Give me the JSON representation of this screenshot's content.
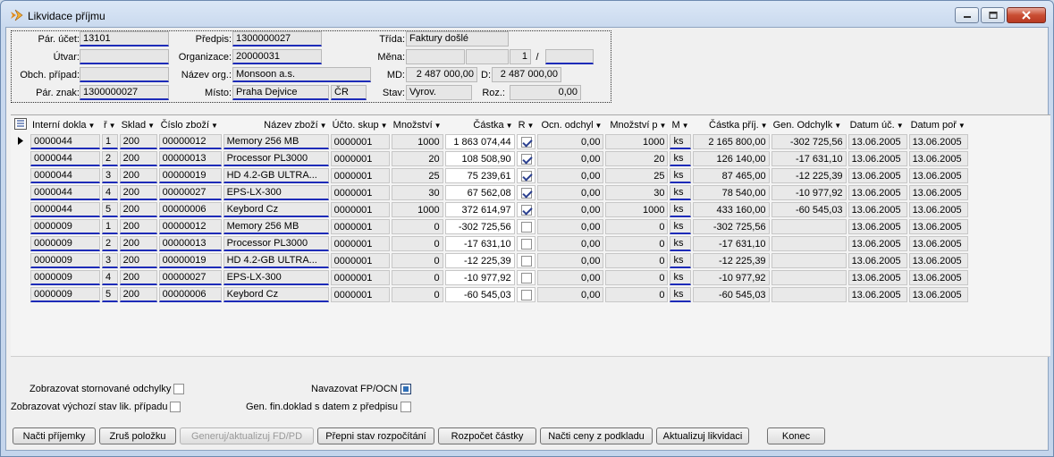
{
  "window": {
    "title": "Likvidace příjmu"
  },
  "header": {
    "par_ucet_label": "Pár. účet:",
    "par_ucet": "13101",
    "predpis_label": "Předpis:",
    "predpis": "1300000027",
    "trida_label": "Třída:",
    "trida": "Faktury došlé",
    "utvar_label": "Útvar:",
    "utvar": "",
    "organizace_label": "Organizace:",
    "organizace": "20000031",
    "mena_label": "Měna:",
    "mena1": "",
    "mena2": "",
    "mena_kurz": "1",
    "mena_slash": "/",
    "mena3": "",
    "obch_pripad_label": "Obch. případ:",
    "obch_pripad": "",
    "nazev_org_label": "Název org.:",
    "nazev_org": "Monsoon a.s.",
    "md_label": "MD:",
    "md": "2 487 000,00",
    "d_label": "D:",
    "d": "2 487 000,00",
    "par_znak_label": "Pár. znak:",
    "par_znak": "1300000027",
    "misto_label": "Místo:",
    "misto": "Praha Dejvice",
    "misto_stat": "ČR",
    "stav_label": "Stav:",
    "stav": "Vyrov.",
    "roz_label": "Roz.:",
    "roz": "0,00"
  },
  "grid": {
    "columns": [
      "Interní dokla",
      "ř",
      "Sklad",
      "Číslo zboží",
      "Název zboží",
      "Účto. skup",
      "Množství",
      "Částka",
      "R",
      "Ocn. odchyl",
      "Množství p",
      "M",
      "Částka příj.",
      "Gen. Odchylk",
      "Datum úč.",
      "Datum poř"
    ],
    "rows": [
      {
        "doc": "0000044",
        "r": "1",
        "sklad": "200",
        "cislo": "00000012",
        "nazev": "Memory 256 MB",
        "ucto": "0000001",
        "mnoz": "1000",
        "castka": "1 863 074,44",
        "chk": true,
        "ocn": "0,00",
        "mnozp": "1000",
        "m": "ks",
        "castkap": "2 165 800,00",
        "gen": "-302 725,56",
        "duc": "13.06.2005",
        "dpor": "13.06.2005"
      },
      {
        "doc": "0000044",
        "r": "2",
        "sklad": "200",
        "cislo": "00000013",
        "nazev": "Processor  PL3000",
        "ucto": "0000001",
        "mnoz": "20",
        "castka": "108 508,90",
        "chk": true,
        "ocn": "0,00",
        "mnozp": "20",
        "m": "ks",
        "castkap": "126 140,00",
        "gen": "-17 631,10",
        "duc": "13.06.2005",
        "dpor": "13.06.2005"
      },
      {
        "doc": "0000044",
        "r": "3",
        "sklad": "200",
        "cislo": "00000019",
        "nazev": "HD 4.2-GB ULTRA...",
        "ucto": "0000001",
        "mnoz": "25",
        "castka": "75 239,61",
        "chk": true,
        "ocn": "0,00",
        "mnozp": "25",
        "m": "ks",
        "castkap": "87 465,00",
        "gen": "-12 225,39",
        "duc": "13.06.2005",
        "dpor": "13.06.2005"
      },
      {
        "doc": "0000044",
        "r": "4",
        "sklad": "200",
        "cislo": "00000027",
        "nazev": "EPS-LX-300",
        "ucto": "0000001",
        "mnoz": "30",
        "castka": "67 562,08",
        "chk": true,
        "ocn": "0,00",
        "mnozp": "30",
        "m": "ks",
        "castkap": "78 540,00",
        "gen": "-10 977,92",
        "duc": "13.06.2005",
        "dpor": "13.06.2005"
      },
      {
        "doc": "0000044",
        "r": "5",
        "sklad": "200",
        "cislo": "00000006",
        "nazev": "Keybord Cz",
        "ucto": "0000001",
        "mnoz": "1000",
        "castka": "372 614,97",
        "chk": true,
        "ocn": "0,00",
        "mnozp": "1000",
        "m": "ks",
        "castkap": "433 160,00",
        "gen": "-60 545,03",
        "duc": "13.06.2005",
        "dpor": "13.06.2005"
      },
      {
        "doc": "0000009",
        "r": "1",
        "sklad": "200",
        "cislo": "00000012",
        "nazev": "Memory 256 MB",
        "ucto": "0000001",
        "mnoz": "0",
        "castka": "-302 725,56",
        "chk": false,
        "ocn": "0,00",
        "mnozp": "0",
        "m": "ks",
        "castkap": "-302 725,56",
        "gen": "",
        "duc": "13.06.2005",
        "dpor": "13.06.2005"
      },
      {
        "doc": "0000009",
        "r": "2",
        "sklad": "200",
        "cislo": "00000013",
        "nazev": "Processor  PL3000",
        "ucto": "0000001",
        "mnoz": "0",
        "castka": "-17 631,10",
        "chk": false,
        "ocn": "0,00",
        "mnozp": "0",
        "m": "ks",
        "castkap": "-17 631,10",
        "gen": "",
        "duc": "13.06.2005",
        "dpor": "13.06.2005"
      },
      {
        "doc": "0000009",
        "r": "3",
        "sklad": "200",
        "cislo": "00000019",
        "nazev": "HD 4.2-GB ULTRA...",
        "ucto": "0000001",
        "mnoz": "0",
        "castka": "-12 225,39",
        "chk": false,
        "ocn": "0,00",
        "mnozp": "0",
        "m": "ks",
        "castkap": "-12 225,39",
        "gen": "",
        "duc": "13.06.2005",
        "dpor": "13.06.2005"
      },
      {
        "doc": "0000009",
        "r": "4",
        "sklad": "200",
        "cislo": "00000027",
        "nazev": "EPS-LX-300",
        "ucto": "0000001",
        "mnoz": "0",
        "castka": "-10 977,92",
        "chk": false,
        "ocn": "0,00",
        "mnozp": "0",
        "m": "ks",
        "castkap": "-10 977,92",
        "gen": "",
        "duc": "13.06.2005",
        "dpor": "13.06.2005"
      },
      {
        "doc": "0000009",
        "r": "5",
        "sklad": "200",
        "cislo": "00000006",
        "nazev": "Keybord Cz",
        "ucto": "0000001",
        "mnoz": "0",
        "castka": "-60 545,03",
        "chk": false,
        "ocn": "0,00",
        "mnozp": "0",
        "m": "ks",
        "castkap": "-60 545,03",
        "gen": "",
        "duc": "13.06.2005",
        "dpor": "13.06.2005"
      }
    ]
  },
  "options": {
    "storno": "Zobrazovat stornované odchylky",
    "vychozi": "Zobrazovat výchozí stav lik. případu",
    "navazovat": "Navazovat FP/OCN",
    "genfin": "Gen. fin.doklad s datem z předpisu"
  },
  "buttons": {
    "nacti_prijemky": "Načti příjemky",
    "zrus_polozku": "Zruš položku",
    "generuj": "Generuj/aktualizuj FD/PD",
    "prepni": "Přepni stav rozpočítání",
    "rozpocet": "Rozpočet částky",
    "nacti_ceny": "Načti ceny z podkladu",
    "aktualizuj": "Aktualizuj likvidaci",
    "konec": "Konec"
  }
}
